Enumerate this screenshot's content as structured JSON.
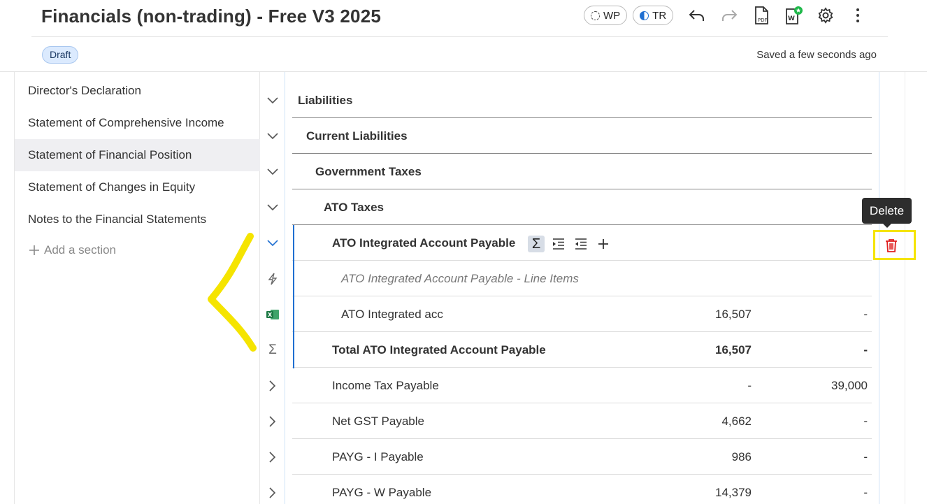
{
  "header": {
    "title": "Financials (non-trading)  - Free V3 2025",
    "badge": "Draft",
    "saved": "Saved a few seconds ago",
    "pills": [
      {
        "label": "WP"
      },
      {
        "label": "TR"
      }
    ],
    "icons": [
      "undo-icon",
      "redo-icon",
      "pdf-icon",
      "word-export-icon",
      "settings-icon",
      "more-vertical-icon"
    ]
  },
  "sidebar": {
    "items": [
      {
        "label": "Director's Declaration"
      },
      {
        "label": "Statement of Comprehensive Income"
      },
      {
        "label": "Statement of Financial Position"
      },
      {
        "label": "Statement of Changes in Equity"
      },
      {
        "label": "Notes to the Financial Statements"
      }
    ],
    "add_label": "Add a section",
    "active_index": 2
  },
  "rows": [
    {
      "label": "Liabilities"
    },
    {
      "label": "Current Liabilities"
    },
    {
      "label": "Government Taxes"
    },
    {
      "label": "ATO Taxes"
    },
    {
      "label": "ATO Integrated Account Payable"
    },
    {
      "label": "ATO Integrated Account Payable - Line Items"
    },
    {
      "label": "ATO Integrated acc",
      "v1": "16,507",
      "v2": "-"
    },
    {
      "label": "Total ATO Integrated Account Payable",
      "v1": "16,507",
      "v2": "-"
    },
    {
      "label": "Income Tax Payable",
      "v1": "-",
      "v2": "39,000"
    },
    {
      "label": "Net GST Payable",
      "v1": "4,662",
      "v2": "-"
    },
    {
      "label": "PAYG - I Payable",
      "v1": "986",
      "v2": "-"
    },
    {
      "label": "PAYG - W Payable",
      "v1": "14,379",
      "v2": "-"
    }
  ],
  "tooltip": "Delete",
  "colors": {
    "accent": "#1f6fd1",
    "delete": "#e02020",
    "highlight": "#f5e400",
    "badge_bg": "#dbeafe"
  }
}
